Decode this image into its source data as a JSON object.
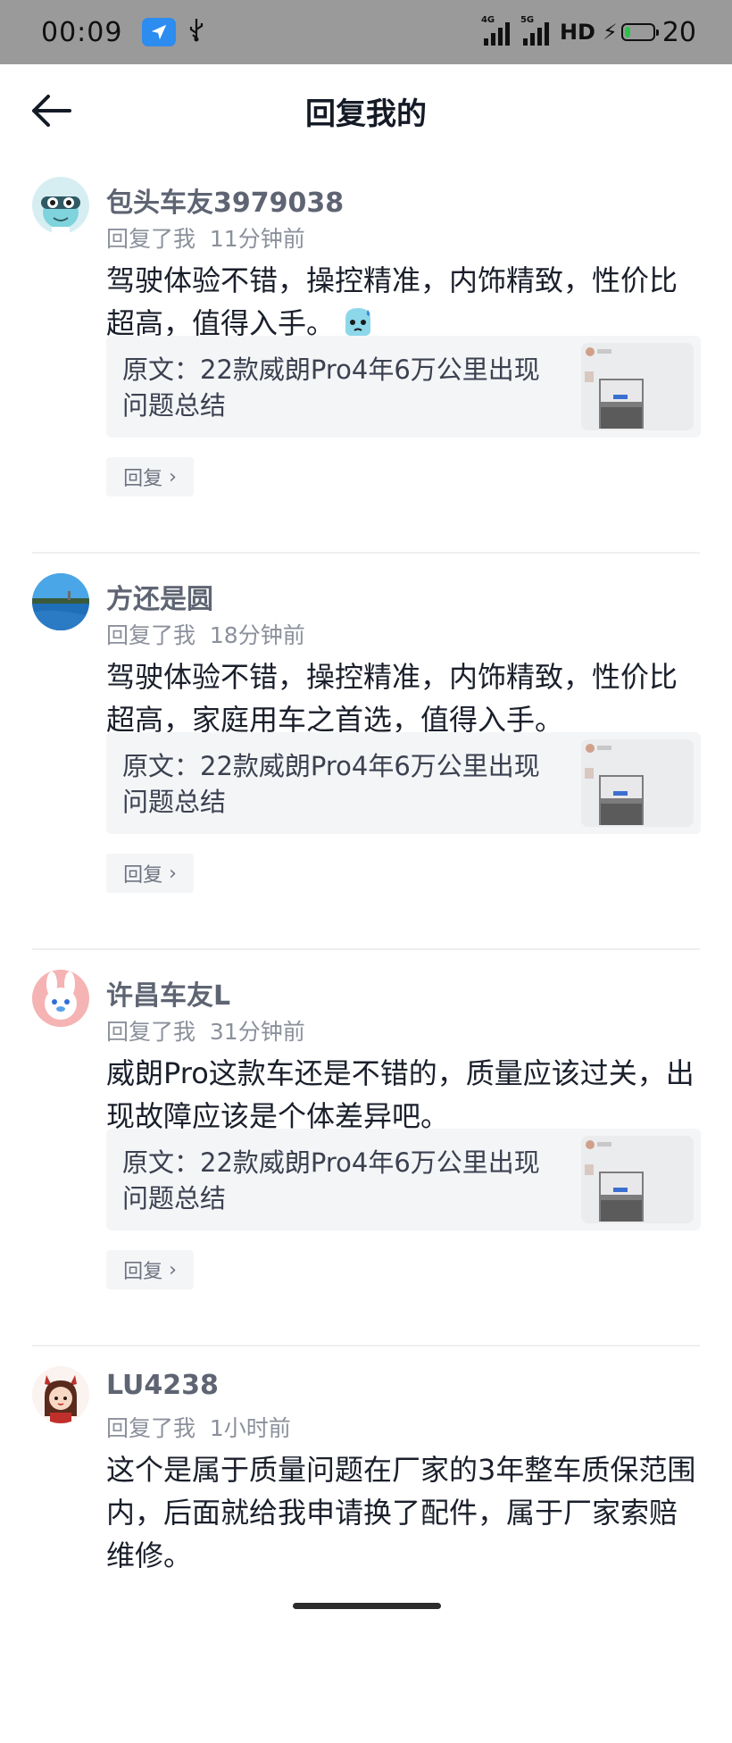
{
  "status_bar": {
    "time": "00:09",
    "network_a": "4G",
    "network_b": "5G",
    "hd_label": "HD",
    "battery_level": 20,
    "battery_text": "20"
  },
  "header": {
    "title": "回复我的"
  },
  "items": [
    {
      "username": "包头车友3979038",
      "meta": "回复了我  11分钟前",
      "content": "驾驶体验不错，操控精准，内饰精致，性价比超高，值得入手。",
      "original": "原文：22款威朗Pro4年6万公里出现问题总结",
      "reply_label": "回复"
    },
    {
      "username": "方还是圆",
      "meta": "回复了我  18分钟前",
      "content": "驾驶体验不错，操控精准，内饰精致，性价比超高，家庭用车之首选，值得入手。",
      "original": "原文：22款威朗Pro4年6万公里出现问题总结",
      "reply_label": "回复"
    },
    {
      "username": "许昌车友L",
      "meta": "回复了我  31分钟前",
      "content": "威朗Pro这款车还是不错的，质量应该过关，出现故障应该是个体差异吧。",
      "original": "原文：22款威朗Pro4年6万公里出现问题总结",
      "reply_label": "回复"
    },
    {
      "username": "LU4238",
      "meta": "回复了我  1小时前",
      "content": "这个是属于质量问题在厂家的3年整车质保范围内，后面就给我申请换了配件，属于厂家索赔维修。"
    }
  ]
}
